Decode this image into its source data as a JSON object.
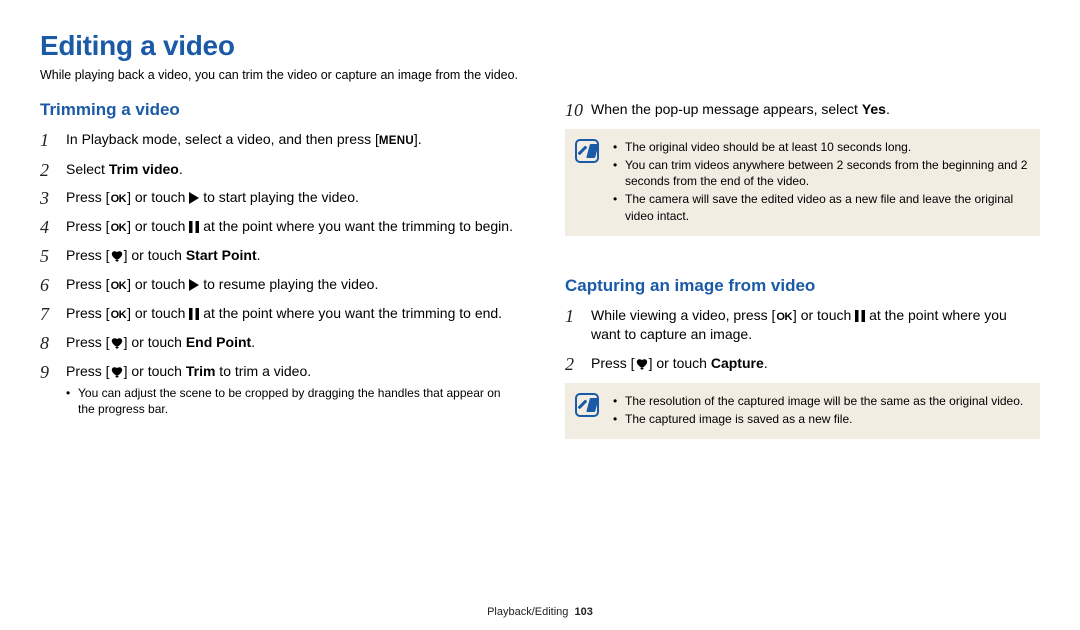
{
  "title": "Editing a video",
  "subtitle": "While playing back a video, you can trim the video or capture an image from the video.",
  "left": {
    "heading": "Trimming a video",
    "steps": {
      "s1a": "In Playback mode, select a video, and then press [",
      "s1b": "].",
      "s2a": "Select ",
      "s2b": "Trim video",
      "s2c": ".",
      "s3a": "Press [",
      "s3b": "] or touch ",
      "s3c": " to start playing the video.",
      "s4a": "Press [",
      "s4b": "] or touch ",
      "s4c": " at the point where you want the trimming to begin.",
      "s5a": "Press [",
      "s5b": "] or touch ",
      "s5c": "Start Point",
      "s5d": ".",
      "s6a": "Press [",
      "s6b": "] or touch ",
      "s6c": " to resume playing the video.",
      "s7a": "Press [",
      "s7b": "] or touch ",
      "s7c": " at the point where you want the trimming to end.",
      "s8a": "Press [",
      "s8b": "] or touch ",
      "s8c": "End Point",
      "s8d": ".",
      "s9a": "Press [",
      "s9b": "] or touch ",
      "s9c": "Trim",
      "s9d": " to trim a video."
    },
    "subnote": "You can adjust the scene to be cropped by dragging the handles that appear on the progress bar."
  },
  "right": {
    "step10a": "When the pop-up message appears, select ",
    "step10b": "Yes",
    "step10c": ".",
    "note1": {
      "n1": "The original video should be at least 10 seconds long.",
      "n2": "You can trim videos anywhere between 2 seconds from the beginning and 2 seconds from the end of the video.",
      "n3": "The camera will save the edited video as a new file and leave the original video intact."
    },
    "heading2": "Capturing an image from video",
    "c1a": "While viewing a video, press [",
    "c1b": "] or touch ",
    "c1c": " at the point where you want to capture an image.",
    "c2a": "Press [",
    "c2b": "] or touch ",
    "c2c": "Capture",
    "c2d": ".",
    "note2": {
      "n1": "The resolution of the captured image will be the same as the original video.",
      "n2": "The captured image is saved as a new file."
    }
  },
  "footer": {
    "section": "Playback/Editing",
    "page": "103"
  }
}
